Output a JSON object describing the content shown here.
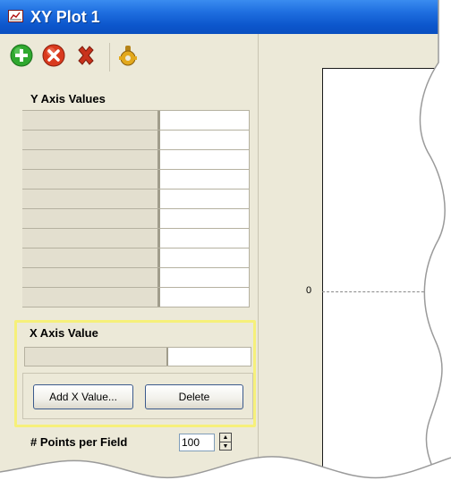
{
  "window": {
    "title": "XY Plot 1",
    "app_icon": "xy-plot-icon"
  },
  "toolbar": {
    "items": [
      {
        "name": "add-icon",
        "color": "#2fa82f"
      },
      {
        "name": "remove-icon",
        "color": "#d93a1e"
      },
      {
        "name": "delete-icon",
        "color": "#c8321c"
      },
      {
        "name": "properties-icon",
        "color": "#e2a81c"
      }
    ]
  },
  "y_axis": {
    "label": "Y Axis Values",
    "rows": 10
  },
  "x_axis": {
    "label": "X Axis Value",
    "add_button": "Add X Value...",
    "delete_button": "Delete"
  },
  "points_per_field": {
    "label": "# Points per Field",
    "value": "100"
  },
  "plot": {
    "zero_label": "0"
  },
  "colors": {
    "titlebar": "#0c56cc",
    "highlight": "#f6f07a",
    "panel": "#ece9d8"
  }
}
